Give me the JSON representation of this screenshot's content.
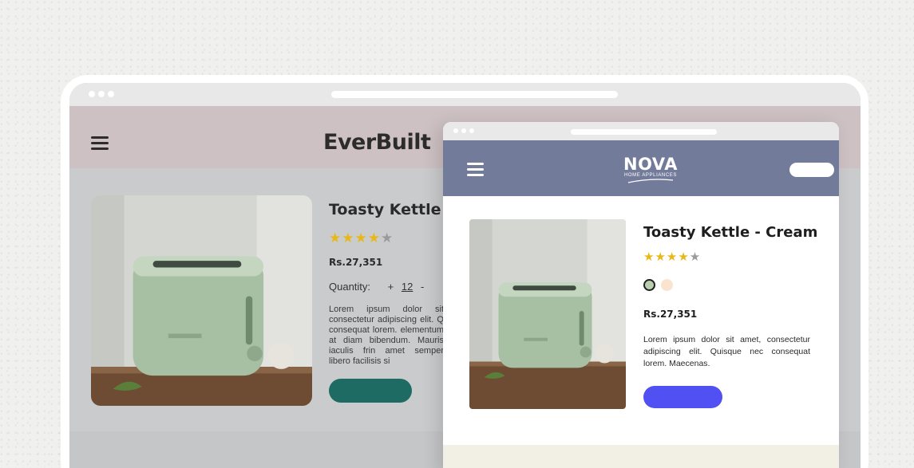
{
  "back_site": {
    "brand": "EverBuilt",
    "product": {
      "title": "Toasty Kettle - C",
      "rating": {
        "filled": "★★★★",
        "empty": "★"
      },
      "price": "Rs.27,351",
      "quantity_label": "Quantity:",
      "quantity_plus": "+",
      "quantity_value": "12",
      "quantity_minus": "-",
      "description": "Lorem ipsum dolor sit consectetur adipiscing elit. Q consequat lorem. elementum at diam bibendum. Mauris iaculis frin amet semper libero facilisis si"
    }
  },
  "front_site": {
    "logo_name": "NOVA",
    "logo_tagline": "HOME APPLIANCES",
    "product": {
      "title": "Toasty Kettle - Cream",
      "rating": {
        "filled": "★★★★",
        "empty": "★"
      },
      "price": "Rs.27,351",
      "description": "Lorem ipsum dolor sit amet, consectetur adipiscing elit. Quisque nec consequat lorem. Maecenas."
    },
    "swatches": [
      {
        "name": "sage",
        "color": "#b9cfae"
      },
      {
        "name": "cream",
        "color": "#fae3cf"
      }
    ]
  },
  "colors": {
    "back_header": "#cec1c3",
    "back_cta": "#1d6b62",
    "front_header": "#737b9b",
    "front_cta": "#5150f2",
    "star": "#e8b818"
  }
}
